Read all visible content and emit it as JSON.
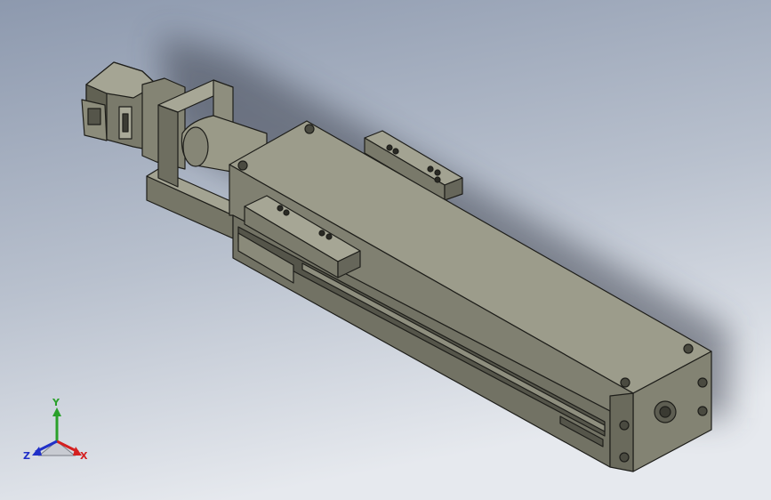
{
  "viewport": {
    "background_top": "#8f9bb0",
    "background_bottom": "#e8ebf0"
  },
  "model": {
    "body_color": "#8a8a78",
    "face_light": "#9c9c8b",
    "face_dark": "#6e6e5f",
    "edge_color": "#1e1e1a"
  },
  "triad": {
    "x_label": "X",
    "y_label": "Y",
    "z_label": "Z",
    "x_color": "#d42020",
    "y_color": "#2aa02a",
    "z_color": "#2030c8"
  }
}
